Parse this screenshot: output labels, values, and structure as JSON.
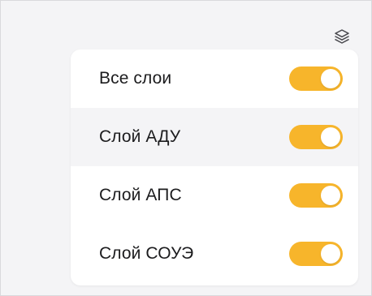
{
  "layers_button": {
    "icon": "layers-icon"
  },
  "layers_panel": {
    "items": [
      {
        "label": "Все слои",
        "enabled": true
      },
      {
        "label": "Слой АДУ",
        "enabled": true
      },
      {
        "label": "Слой АПС",
        "enabled": true
      },
      {
        "label": "Слой СОУЭ",
        "enabled": true
      }
    ]
  },
  "colors": {
    "toggle_on": "#f7b52b",
    "hover_row": "#f4f4f6",
    "background": "#f4f4f6"
  }
}
